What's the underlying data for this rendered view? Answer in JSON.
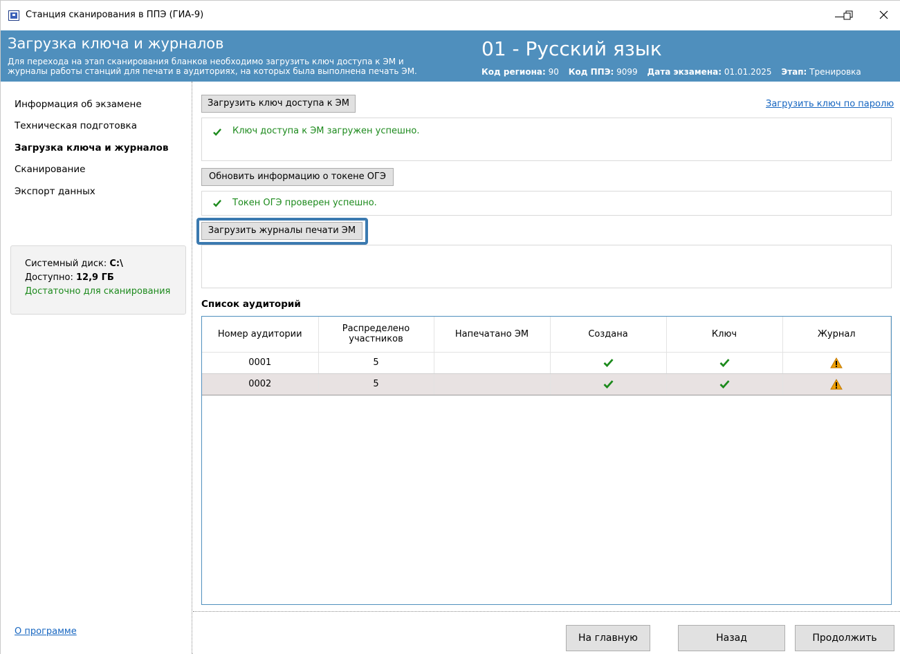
{
  "window": {
    "title": "Станция сканирования в ППЭ (ГИА-9)"
  },
  "header": {
    "title": "Загрузка ключа и журналов",
    "description_line1": "Для перехода на этап сканирования бланков необходимо загрузить ключ доступа к ЭМ и",
    "description_line2": "журналы работы станций для печати в аудиториях, на которых была выполнена печать ЭМ.",
    "subject": "01 - Русский язык",
    "region_label": "Код региона:",
    "region_value": "90",
    "ppe_label": "Код ППЭ:",
    "ppe_value": "9099",
    "exam_date_label": "Дата экзамена:",
    "exam_date_value": "01.01.2025",
    "stage_label": "Этап:",
    "stage_value": "Тренировка"
  },
  "sidebar": {
    "items": [
      {
        "label": "Информация об экзамене"
      },
      {
        "label": "Техническая подготовка"
      },
      {
        "label": "Загрузка ключа и журналов"
      },
      {
        "label": "Сканирование"
      },
      {
        "label": "Экспорт данных"
      }
    ],
    "disk": {
      "system_label": "Системный диск:",
      "system_value": "C:\\",
      "available_label": "Доступно:",
      "available_value": "12,9 ГБ",
      "status": "Достаточно для сканирования"
    },
    "about": "О программе"
  },
  "main": {
    "load_key_button": "Загрузить ключ доступа к ЭМ",
    "load_key_password_link": "Загрузить ключ по паролю",
    "key_status": "Ключ доступа к ЭМ загружен успешно.",
    "refresh_token_button": "Обновить информацию о токене ОГЭ",
    "token_status": "Токен ОГЭ проверен успешно.",
    "load_journals_button": "Загрузить журналы печати ЭМ",
    "rooms_title": "Список аудиторий",
    "table": {
      "headers": [
        "Номер аудитории",
        "Распределено участников",
        "Напечатано ЭМ",
        "Создана",
        "Ключ",
        "Журнал"
      ],
      "rows": [
        {
          "room": "0001",
          "distributed": "5",
          "printed": "",
          "created": "check-icon",
          "key": "check-icon",
          "journal": "warning-icon"
        },
        {
          "room": "0002",
          "distributed": "5",
          "printed": "",
          "created": "check-icon",
          "key": "check-icon",
          "journal": "warning-icon"
        }
      ]
    },
    "home_button": "На главную",
    "back_button": "Назад",
    "continue_button": "Продолжить"
  },
  "colors": {
    "header_bg": "#4f8fbd",
    "success": "#1c8a1c",
    "link": "#1565c0",
    "warning": "#f0a000"
  }
}
